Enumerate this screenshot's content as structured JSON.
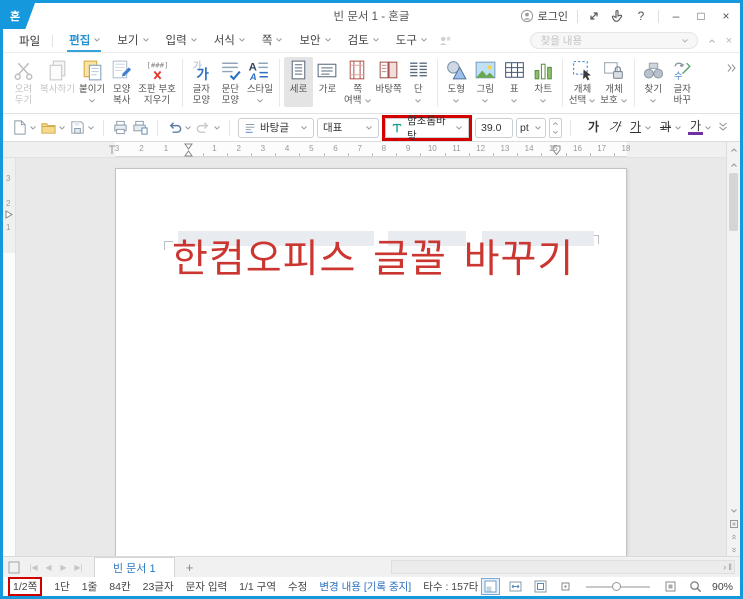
{
  "window": {
    "title": "빈 문서 1 - 혼글",
    "logo_glyph": "혼"
  },
  "titlebar": {
    "login_label": "로그인"
  },
  "menubar": {
    "file_label": "파일",
    "items": [
      {
        "id": "edit",
        "label": "편집",
        "active": true
      },
      {
        "id": "view",
        "label": "보기"
      },
      {
        "id": "input",
        "label": "입력"
      },
      {
        "id": "format",
        "label": "서식"
      },
      {
        "id": "page",
        "label": "쪽"
      },
      {
        "id": "security",
        "label": "보안"
      },
      {
        "id": "review",
        "label": "검토"
      },
      {
        "id": "tools",
        "label": "도구"
      }
    ],
    "search_placeholder": "찾을 내용"
  },
  "ribbon": {
    "groups": [
      {
        "buttons": [
          {
            "id": "cut",
            "icon": "scissors-icon",
            "line1": "오려",
            "line2": "두기",
            "disabled": true
          },
          {
            "id": "copy",
            "icon": "copy-icon",
            "line1": "복사하기",
            "disabled": true
          },
          {
            "id": "paste",
            "icon": "paste-icon",
            "line1": "붙이기",
            "dropdown": true
          },
          {
            "id": "format-painter",
            "icon": "format-painter-icon",
            "line1": "모양",
            "line2": "복사"
          },
          {
            "id": "erase-marks",
            "icon": "erase-marks-icon",
            "line1": "조판 부호",
            "line2": "지우기"
          }
        ]
      },
      {
        "buttons": [
          {
            "id": "char-shape",
            "icon": "char-shape-icon",
            "line1": "글자",
            "line2": "모양"
          },
          {
            "id": "para-shape",
            "icon": "para-shape-icon",
            "line1": "문단",
            "line2": "모양"
          },
          {
            "id": "style",
            "icon": "style-icon",
            "line1": "스타일",
            "dropdown": true
          }
        ]
      },
      {
        "buttons": [
          {
            "id": "vertical",
            "icon": "vertical-icon",
            "line1": "세로",
            "selected": true
          },
          {
            "id": "horizontal",
            "icon": "horizontal-icon",
            "line1": "가로"
          },
          {
            "id": "page-margin",
            "icon": "page-margin-icon",
            "line1": "쪽",
            "line2": "여백",
            "dropdown": true
          },
          {
            "id": "master-page",
            "icon": "master-page-icon",
            "line1": "바탕쪽"
          },
          {
            "id": "columns",
            "icon": "columns-icon",
            "line1": "단",
            "dropdown": true
          }
        ]
      },
      {
        "buttons": [
          {
            "id": "shape",
            "icon": "shape-icon",
            "line1": "도형",
            "dropdown": true
          },
          {
            "id": "picture",
            "icon": "picture-icon",
            "line1": "그림",
            "dropdown": true
          },
          {
            "id": "table",
            "icon": "table-icon",
            "line1": "표",
            "dropdown": true
          },
          {
            "id": "chart",
            "icon": "chart-icon",
            "line1": "차트",
            "dropdown": true
          }
        ]
      },
      {
        "buttons": [
          {
            "id": "object-select",
            "icon": "object-select-icon",
            "line1": "개체",
            "line2": "선택",
            "dropdown": true
          },
          {
            "id": "object-protect",
            "icon": "object-protect-icon",
            "line1": "개체",
            "line2": "보호",
            "dropdown": true
          }
        ]
      },
      {
        "buttons": [
          {
            "id": "find",
            "icon": "find-icon",
            "line1": "찾기",
            "dropdown": true
          },
          {
            "id": "replace",
            "icon": "replace-icon",
            "line1": "글자",
            "line2": "바꾸"
          }
        ]
      }
    ]
  },
  "quickbar": {
    "file_buttons": [
      {
        "id": "new-document",
        "dropdown": true
      },
      {
        "id": "open",
        "dropdown": true
      },
      {
        "id": "save",
        "dropdown": true
      },
      {
        "sep": true
      },
      {
        "id": "print"
      },
      {
        "id": "print-preview"
      },
      {
        "sep": true
      },
      {
        "id": "undo",
        "dropdown": true
      },
      {
        "id": "redo",
        "dropdown": true,
        "disabled": true
      }
    ],
    "style_combo": "바탕글",
    "preset_combo": "대표",
    "font_combo": "함초롬바탕",
    "font_size": "39.0",
    "size_unit": "pt",
    "char_buttons": [
      {
        "id": "bold",
        "label": "가"
      },
      {
        "id": "italic",
        "label": "가"
      },
      {
        "id": "underline",
        "label": "가",
        "dropdown": true
      },
      {
        "id": "strike",
        "label": "과",
        "dropdown": true
      },
      {
        "id": "font-color",
        "label": "가",
        "dropdown": true,
        "color": "#7030a0"
      }
    ]
  },
  "ruler": {
    "left_numbers": [
      "3",
      "2",
      "1"
    ],
    "numbers": [
      "1",
      "2",
      "3",
      "4",
      "5",
      "6",
      "7",
      "8",
      "9",
      "10",
      "11",
      "12",
      "13",
      "14",
      "15",
      "16",
      "17",
      "18"
    ],
    "v_numbers": [
      "3",
      "2",
      "1"
    ]
  },
  "document": {
    "text": "한컴오피스 글꼴 바꾸기",
    "text_color": "#cb3631"
  },
  "tabbar": {
    "tab_label": "빈 문서 1"
  },
  "statusbar": {
    "items": [
      {
        "id": "page",
        "label": "1/2쪽",
        "boxed": true
      },
      {
        "id": "column",
        "label": "1단"
      },
      {
        "id": "line",
        "label": "1줄"
      },
      {
        "id": "cell",
        "label": "84칸"
      },
      {
        "id": "char-count",
        "label": "23글자"
      },
      {
        "id": "input-mode",
        "label": "문자 입력"
      },
      {
        "id": "section",
        "label": "1/1 구역"
      },
      {
        "id": "edit-mode",
        "label": "수정"
      },
      {
        "id": "change-tracking",
        "label": "변경 내용 [기록 중지]",
        "link": true
      },
      {
        "id": "keystrokes",
        "label": "타수 : 157타"
      }
    ],
    "zoom_level": "90%"
  },
  "colors": {
    "accent_blue": "#1598dc",
    "annotation_red": "#d40000",
    "document_text_red": "#cb3631",
    "link_blue": "#2b6fbe",
    "menu_active_blue": "#2492d0"
  }
}
